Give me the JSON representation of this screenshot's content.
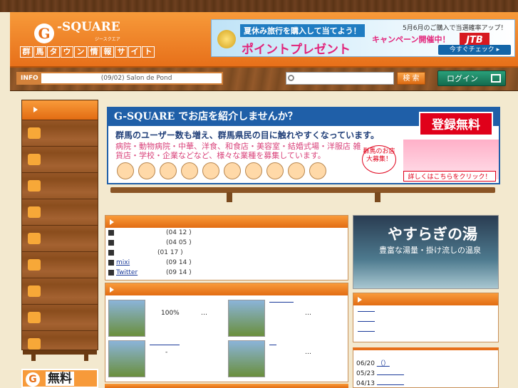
{
  "header": {
    "logo_mark": "G",
    "logo_name": "-SQUARE",
    "logo_sub": "ジースクエア",
    "tagline": [
      "群",
      "馬",
      "タ",
      "ウ",
      "ン",
      "情",
      "報",
      "サ",
      "イ",
      "ト"
    ]
  },
  "ad": {
    "line1": "夏休み旅行を購入して当てよう！",
    "line2": "ポイントプレゼント",
    "line3": "5月6月のご購入で当選確率アップ！",
    "line4": "キャンペーン開催中！",
    "brand": "JTB",
    "cta": "今すぐチェック ▸"
  },
  "infobar": {
    "label": "INFO",
    "text": "(09/02)  Salon de Pond",
    "search_placeholder": "",
    "search_button": "検 索",
    "login_button": "ログイン"
  },
  "sidebar": {
    "icons": [
      "food-icon",
      "hot-spring-icon",
      "shopping-bag-icon",
      "sports-ball-icon",
      "pencil-icon",
      "sparkle-icon",
      "paw-house-icon",
      "house-icon",
      "car-icon",
      "hand-icon"
    ]
  },
  "promo": {
    "title": "G-SQUARE でお店を紹介しませんか？",
    "line1": "群馬のユーザー数も増え、群馬県民の目に触れやすくなっています。",
    "line2": "病院・動物病院・中華、洋食、和食店・美容室・結婚式場・洋服店 雑貨店・学校・企業などなど、様々な業種を募集しています。",
    "free": "登録無料",
    "bubble": "群馬のお店大募集！",
    "click": "詳しくはこちらをクリック！"
  },
  "news": {
    "items": [
      {
        "title": "",
        "date": "(04 12 )"
      },
      {
        "title": "",
        "date": "(04 05 )"
      },
      {
        "title": "",
        "date": "(01 17 )"
      },
      {
        "title": "mixi",
        "date": "(09 14 )"
      },
      {
        "title": "Twitter",
        "date": "(09 14 )"
      }
    ]
  },
  "shops": {
    "item1_text": "100%",
    "item1_more": "…",
    "item2_more": "…",
    "item3_text": "-",
    "item4_more": "…"
  },
  "onsen": {
    "title": "やすらぎの湯",
    "subtitle": "豊富な湯量・掛け流しの温泉"
  },
  "right_dates": [
    {
      "date": "06/20",
      "link": "（）"
    },
    {
      "date": "05/23",
      "link": ""
    },
    {
      "date": "04/13",
      "link": ""
    }
  ],
  "free_badge": {
    "g": "G",
    "text": "無料"
  }
}
